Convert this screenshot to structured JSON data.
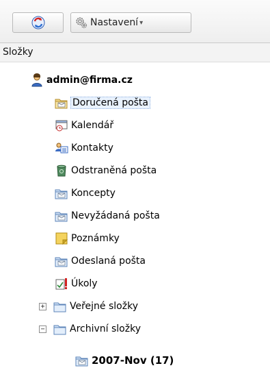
{
  "toolbar": {
    "settings_label": "Nastavení",
    "settings_caret": "▾"
  },
  "folders_header": "Složky",
  "tree": {
    "account": "admin@firma.cz",
    "inbox": "Doručená pošta",
    "calendar": "Kalendář",
    "contacts": "Kontakty",
    "deleted": "Odstraněná pošta",
    "drafts": "Koncepty",
    "junk": "Nevyžádaná pošta",
    "notes": "Poznámky",
    "sent": "Odeslaná pošta",
    "tasks": "Úkoly",
    "public": "Veřejné složky",
    "archive": "Archivní složky",
    "archive_sub": "2007-Nov (17)",
    "expand_plus": "+",
    "expand_minus": "−"
  },
  "colors": {
    "folder": "#e9c865",
    "selection": "#e9f2fd"
  }
}
